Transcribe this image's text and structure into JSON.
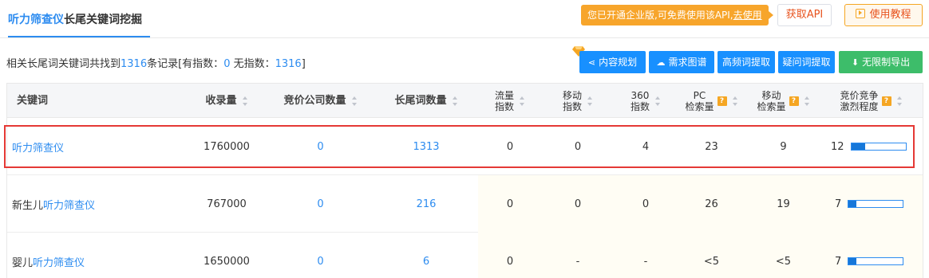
{
  "tabs": {
    "active_prefix": "听力筛查仪",
    "active_suffix": "长尾关键词挖掘"
  },
  "header": {
    "notice_text": "您已开通企业版,可免费使用该API,",
    "notice_link": "去使用",
    "get_api_label": "获取API",
    "tutorial_label": "使用教程"
  },
  "summary": {
    "prefix": "相关长尾词关键词共找到",
    "total": "1316",
    "mid": "条记录[有指数：",
    "with_index": "0",
    "mid2": " 无指数：",
    "without_index": "1316",
    "suffix": "]"
  },
  "actions": {
    "content_plan": "内容规划",
    "demand_map": "需求图谱",
    "high_freq": "高频词提取",
    "question_words": "疑问词提取",
    "export": "无限制导出"
  },
  "columns": {
    "keyword": "关键词",
    "indexed": "收录量",
    "bid_companies": "竞价公司数量",
    "longtail_count": "长尾词数量",
    "flow_index_1": "流量",
    "flow_index_2": "指数",
    "mobile_index_1": "移动",
    "mobile_index_2": "指数",
    "index360_1": "360",
    "index360_2": "指数",
    "pc_search_1": "PC",
    "pc_search_2": "检索量",
    "mobile_search_1": "移动",
    "mobile_search_2": "检索量",
    "competition_1": "竞价竞争",
    "competition_2": "激烈程度",
    "help_mark": "?"
  },
  "rows": [
    {
      "kw_prefix": "",
      "kw_hl": "听力筛查仪",
      "indexed": "1760000",
      "bid": "0",
      "longtail": "1313",
      "flow": "0",
      "mobile_idx": "0",
      "idx360": "4",
      "pc": "23",
      "mobile_search": "9",
      "competition": "12",
      "competition_level": 0.25
    },
    {
      "kw_prefix": "新生儿",
      "kw_hl": "听力筛查仪",
      "indexed": "767000",
      "bid": "0",
      "longtail": "216",
      "flow": "0",
      "mobile_idx": "0",
      "idx360": "0",
      "pc": "26",
      "mobile_search": "19",
      "competition": "7",
      "competition_level": 0.14
    },
    {
      "kw_prefix": "婴儿",
      "kw_hl": "听力筛查仪",
      "indexed": "1650000",
      "bid": "0",
      "longtail": "6",
      "flow": "0",
      "mobile_idx": "-",
      "idx360": "-",
      "pc": "<5",
      "mobile_search": "<5",
      "competition": "7",
      "competition_level": 0.14
    }
  ],
  "colors": {
    "accent": "#2d8cf0",
    "notice": "#f7a52b",
    "export": "#3dbd6a",
    "highlight": "#e53935"
  }
}
